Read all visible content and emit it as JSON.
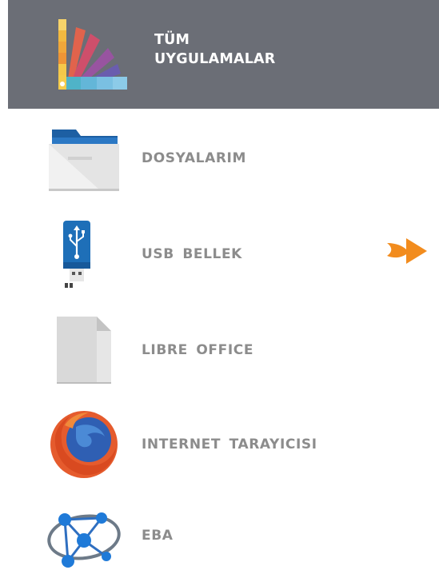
{
  "header": {
    "title_line1": "TÜM",
    "title_line2": "UYGULAMALAR",
    "logo_icon": "all-apps-fan-logo"
  },
  "apps": [
    {
      "label": "DOSYALARIM",
      "icon": "folder-icon"
    },
    {
      "label": "USB BELLEK",
      "icon": "usb-drive-icon"
    },
    {
      "label": "LIBRE OFFICE",
      "icon": "document-icon"
    },
    {
      "label": "INTERNET TARAYICISI",
      "icon": "firefox-icon"
    },
    {
      "label": "EBA",
      "icon": "eba-network-icon"
    }
  ],
  "pointer": {
    "icon": "arrow-right-icon",
    "color": "#f28c1e"
  },
  "colors": {
    "header_bg": "#6b6e76",
    "label_text": "#8c8c8c",
    "header_text": "#ffffff"
  }
}
